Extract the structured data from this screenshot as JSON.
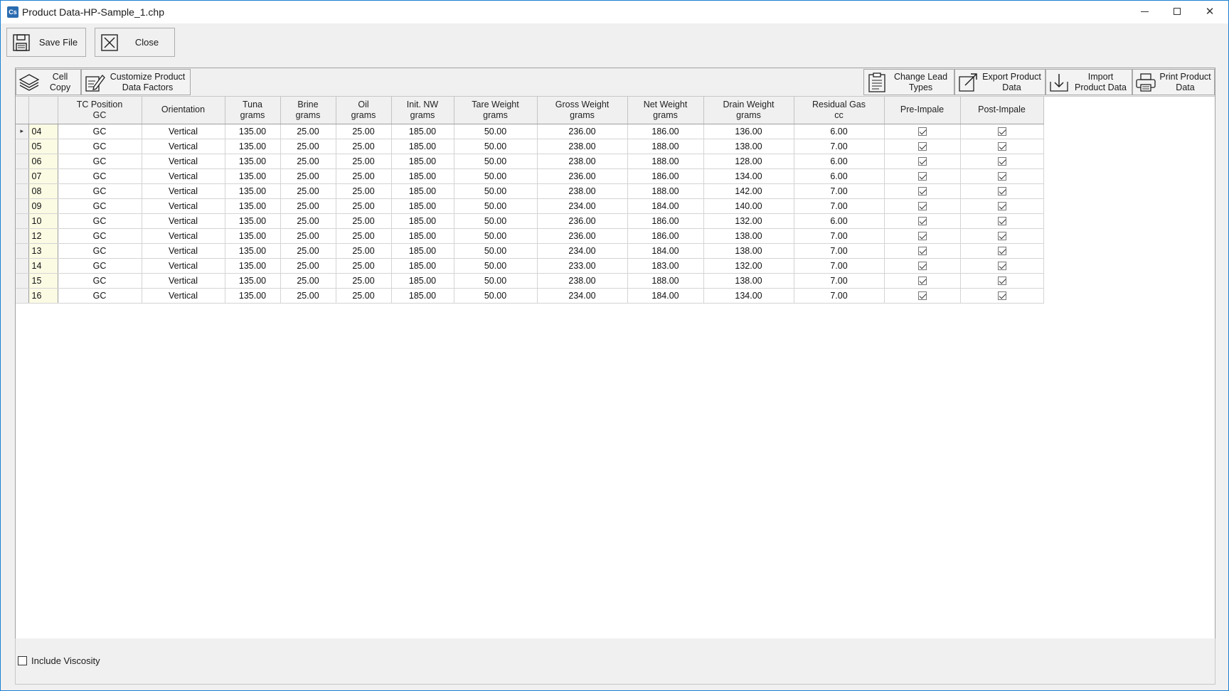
{
  "window": {
    "title": "Product Data-HP-Sample_1.chp",
    "app_icon_text": "Cs"
  },
  "toolbar": {
    "save_label": "Save File",
    "close_label": "Close"
  },
  "grid_toolbar": {
    "cell_copy": "Cell\nCopy",
    "customize": "Customize Product\nData Factors",
    "change_lead": "Change Lead\nTypes",
    "export": "Export Product\nData",
    "import": "Import\nProduct Data",
    "print": "Print Product\nData"
  },
  "table": {
    "columns": [
      "TC Position\nGC",
      "Orientation",
      "Tuna\ngrams",
      "Brine\ngrams",
      "Oil\ngrams",
      "Init. NW\ngrams",
      "Tare Weight\ngrams",
      "Gross Weight\ngrams",
      "Net Weight\ngrams",
      "Drain Weight\ngrams",
      "Residual Gas\ncc",
      "Pre-Impale",
      "Post-Impale"
    ],
    "current_row_marker": "▸",
    "rows": [
      {
        "id": "04",
        "tc": "GC",
        "orientation": "Vertical",
        "tuna": "135.00",
        "brine": "25.00",
        "oil": "25.00",
        "init_nw": "185.00",
        "tare": "50.00",
        "gross": "236.00",
        "net": "186.00",
        "drain": "136.00",
        "gas": "6.00",
        "pre": true,
        "post": true
      },
      {
        "id": "05",
        "tc": "GC",
        "orientation": "Vertical",
        "tuna": "135.00",
        "brine": "25.00",
        "oil": "25.00",
        "init_nw": "185.00",
        "tare": "50.00",
        "gross": "238.00",
        "net": "188.00",
        "drain": "138.00",
        "gas": "7.00",
        "pre": true,
        "post": true
      },
      {
        "id": "06",
        "tc": "GC",
        "orientation": "Vertical",
        "tuna": "135.00",
        "brine": "25.00",
        "oil": "25.00",
        "init_nw": "185.00",
        "tare": "50.00",
        "gross": "238.00",
        "net": "188.00",
        "drain": "128.00",
        "gas": "6.00",
        "pre": true,
        "post": true
      },
      {
        "id": "07",
        "tc": "GC",
        "orientation": "Vertical",
        "tuna": "135.00",
        "brine": "25.00",
        "oil": "25.00",
        "init_nw": "185.00",
        "tare": "50.00",
        "gross": "236.00",
        "net": "186.00",
        "drain": "134.00",
        "gas": "6.00",
        "pre": true,
        "post": true
      },
      {
        "id": "08",
        "tc": "GC",
        "orientation": "Vertical",
        "tuna": "135.00",
        "brine": "25.00",
        "oil": "25.00",
        "init_nw": "185.00",
        "tare": "50.00",
        "gross": "238.00",
        "net": "188.00",
        "drain": "142.00",
        "gas": "7.00",
        "pre": true,
        "post": true
      },
      {
        "id": "09",
        "tc": "GC",
        "orientation": "Vertical",
        "tuna": "135.00",
        "brine": "25.00",
        "oil": "25.00",
        "init_nw": "185.00",
        "tare": "50.00",
        "gross": "234.00",
        "net": "184.00",
        "drain": "140.00",
        "gas": "7.00",
        "pre": true,
        "post": true
      },
      {
        "id": "10",
        "tc": "GC",
        "orientation": "Vertical",
        "tuna": "135.00",
        "brine": "25.00",
        "oil": "25.00",
        "init_nw": "185.00",
        "tare": "50.00",
        "gross": "236.00",
        "net": "186.00",
        "drain": "132.00",
        "gas": "6.00",
        "pre": true,
        "post": true
      },
      {
        "id": "12",
        "tc": "GC",
        "orientation": "Vertical",
        "tuna": "135.00",
        "brine": "25.00",
        "oil": "25.00",
        "init_nw": "185.00",
        "tare": "50.00",
        "gross": "236.00",
        "net": "186.00",
        "drain": "138.00",
        "gas": "7.00",
        "pre": true,
        "post": true
      },
      {
        "id": "13",
        "tc": "GC",
        "orientation": "Vertical",
        "tuna": "135.00",
        "brine": "25.00",
        "oil": "25.00",
        "init_nw": "185.00",
        "tare": "50.00",
        "gross": "234.00",
        "net": "184.00",
        "drain": "138.00",
        "gas": "7.00",
        "pre": true,
        "post": true
      },
      {
        "id": "14",
        "tc": "GC",
        "orientation": "Vertical",
        "tuna": "135.00",
        "brine": "25.00",
        "oil": "25.00",
        "init_nw": "185.00",
        "tare": "50.00",
        "gross": "233.00",
        "net": "183.00",
        "drain": "132.00",
        "gas": "7.00",
        "pre": true,
        "post": true
      },
      {
        "id": "15",
        "tc": "GC",
        "orientation": "Vertical",
        "tuna": "135.00",
        "brine": "25.00",
        "oil": "25.00",
        "init_nw": "185.00",
        "tare": "50.00",
        "gross": "238.00",
        "net": "188.00",
        "drain": "138.00",
        "gas": "7.00",
        "pre": true,
        "post": true
      },
      {
        "id": "16",
        "tc": "GC",
        "orientation": "Vertical",
        "tuna": "135.00",
        "brine": "25.00",
        "oil": "25.00",
        "init_nw": "185.00",
        "tare": "50.00",
        "gross": "234.00",
        "net": "184.00",
        "drain": "134.00",
        "gas": "7.00",
        "pre": true,
        "post": true
      }
    ]
  },
  "footer": {
    "include_viscosity_label": "Include Viscosity",
    "include_viscosity_checked": false
  },
  "colors": {
    "window_border": "#1b7fd1",
    "row_header_bg": "#fbfbe4",
    "chrome_bg": "#f0f0f0"
  }
}
